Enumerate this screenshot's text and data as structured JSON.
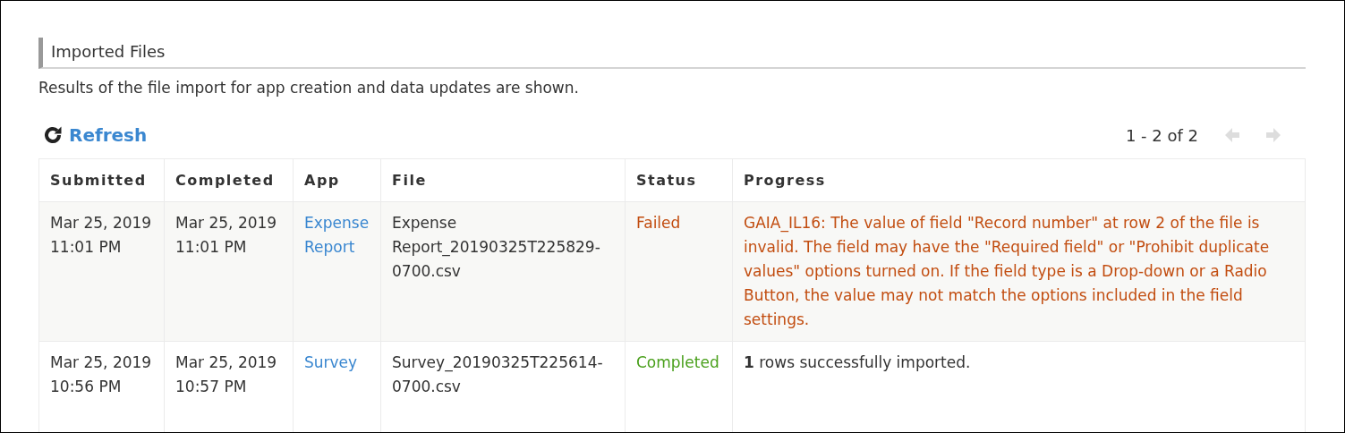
{
  "section": {
    "title": "Imported Files",
    "description": "Results of the file import for app creation and data updates are shown."
  },
  "toolbar": {
    "refresh": "Refresh",
    "range": "1 - 2 of 2",
    "prev": {
      "disabled": true
    },
    "next": {
      "disabled": true
    }
  },
  "table": {
    "columns": [
      "Submitted",
      "Completed",
      "App",
      "File",
      "Status",
      "Progress"
    ],
    "rows": [
      {
        "submitted": "Mar 25, 2019 11:01 PM",
        "completed": "Mar 25, 2019 11:01 PM",
        "app": "Expense Report",
        "file": "Expense Report_20190325T225829-0700.csv",
        "status": {
          "text": "Failed",
          "kind": "failed"
        },
        "progress": "GAIA_IL16: The value of field \"Record number\" at row 2 of the file is invalid. The field may have the \"Required field\" or \"Prohibit duplicate values\" options turned on. If the field type is a Drop-down or a Radio Button, the value may not match the options included in the field settings."
      },
      {
        "submitted": "Mar 25, 2019 10:56 PM",
        "completed": "Mar 25, 2019 10:57 PM",
        "app": "Survey",
        "file": "Survey_20190325T225614-0700.csv",
        "status": {
          "text": "Completed",
          "kind": "completed"
        },
        "progress": "**1** rows successfully imported."
      }
    ]
  }
}
